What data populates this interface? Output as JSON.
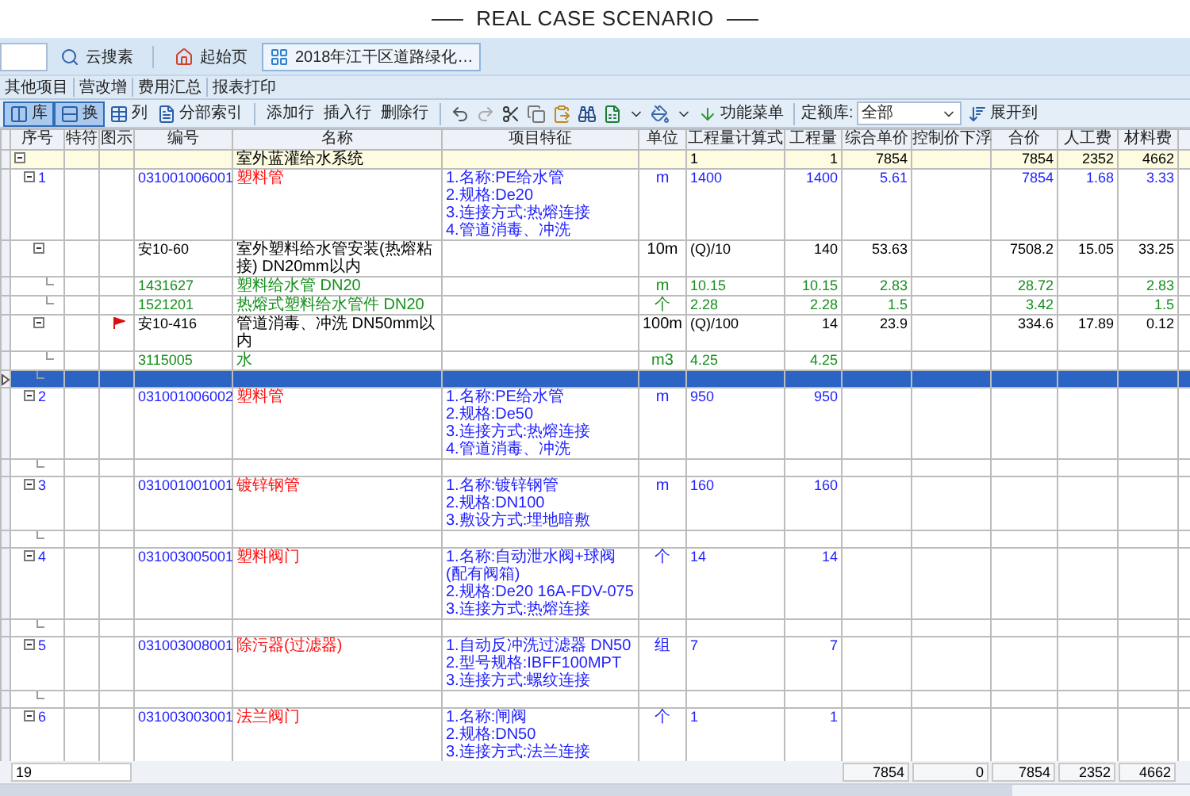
{
  "page_title": "REAL CASE SCENARIO",
  "cloud_search": {
    "label": "云搜素"
  },
  "tabs": [
    {
      "label": "起始页",
      "kind": "home",
      "selected": false
    },
    {
      "label": "2018年江干区道路绿化…",
      "kind": "document",
      "selected": true
    }
  ],
  "menu": [
    "其他项目",
    "营改增",
    "费用汇总",
    "报表打印"
  ],
  "view_toggles": [
    {
      "label": "库",
      "kind": "columns",
      "selected": true
    },
    {
      "label": "换",
      "kind": "rows",
      "selected": true
    }
  ],
  "toolbar_buttons": [
    {
      "label": "列",
      "kind": "table"
    },
    {
      "label": "分部索引",
      "kind": "index"
    }
  ],
  "row_actions": [
    "添加行",
    "插入行",
    "删除行"
  ],
  "function_menu": "功能菜单",
  "quota_library": {
    "label": "定额库:",
    "value": "全部"
  },
  "expand_to": "展开到",
  "table": {
    "columns": [
      "序号",
      "特符",
      "图示",
      "编号",
      "名称",
      "项目特征",
      "单位",
      "工程量计算式",
      "工程量",
      "综合单价",
      "控制价下浮",
      "合价",
      "人工费",
      "材料费"
    ],
    "rows": [
      {
        "kind": "group",
        "selected": false,
        "flagged": false,
        "expanded": true,
        "name": "室外蓝灌给水系统",
        "formula": "1",
        "quantity": "1",
        "unit_price": "7854",
        "total": "7854",
        "labor": "2352",
        "material": "4662",
        "children": [
          {
            "kind": "item",
            "selected": false,
            "flagged": false,
            "expanded": true,
            "no": "1",
            "code": "031001006001",
            "name": "塑料管",
            "features": [
              "1.名称:PE给水管",
              "2.规格:De20",
              "3.连接方式:热熔连接",
              "4.管道消毒、冲洗"
            ],
            "unit": "m",
            "formula": "1400",
            "quantity": "1400",
            "unit_price": "5.61",
            "total": "7854",
            "labor": "1.68",
            "material": "3.33",
            "children": [
              {
                "kind": "quota",
                "selected": false,
                "flagged": false,
                "expanded": true,
                "code": "安10-60",
                "name": "室外塑料给水管安装(热熔粘接) DN20mm以内",
                "unit": "10m",
                "formula": "(Q)/10",
                "quantity": "140",
                "unit_price": "53.63",
                "total": "7508.2",
                "labor": "15.05",
                "material": "33.25",
                "children": [
                  {
                    "kind": "material",
                    "selected": false,
                    "flagged": false,
                    "code": "1431627",
                    "name": "塑料给水管 DN20",
                    "unit": "m",
                    "formula": "10.15",
                    "quantity": "10.15",
                    "unit_price": "2.83",
                    "total": "28.72",
                    "material": "2.83"
                  },
                  {
                    "kind": "material",
                    "selected": false,
                    "flagged": false,
                    "code": "1521201",
                    "name": "热熔式塑料给水管件 DN20",
                    "unit": "个",
                    "formula": "2.28",
                    "quantity": "2.28",
                    "unit_price": "1.5",
                    "total": "3.42",
                    "material": "1.5"
                  }
                ]
              },
              {
                "kind": "quota",
                "selected": false,
                "flagged": true,
                "expanded": true,
                "code": "安10-416",
                "name": "管道消毒、冲洗 DN50mm以内",
                "unit": "100m",
                "formula": "(Q)/100",
                "quantity": "14",
                "unit_price": "23.9",
                "total": "334.6",
                "labor": "17.89",
                "material": "0.12",
                "children": [
                  {
                    "kind": "material",
                    "selected": false,
                    "flagged": false,
                    "code": "3115005",
                    "name": "水",
                    "unit": "m3",
                    "formula": "4.25",
                    "quantity": "4.25"
                  }
                ]
              },
              {
                "kind": "blank",
                "selected": true,
                "flagged": false
              }
            ]
          },
          {
            "kind": "item",
            "selected": false,
            "flagged": false,
            "expanded": true,
            "no": "2",
            "code": "031001006002",
            "name": "塑料管",
            "features": [
              "1.名称:PE给水管",
              "2.规格:De50",
              "3.连接方式:热熔连接",
              "4.管道消毒、冲洗"
            ],
            "unit": "m",
            "formula": "950",
            "quantity": "950",
            "children": [
              {
                "kind": "blank",
                "selected": false,
                "flagged": false
              }
            ]
          },
          {
            "kind": "item",
            "selected": false,
            "flagged": false,
            "expanded": true,
            "no": "3",
            "code": "031001001001",
            "name": "镀锌钢管",
            "features": [
              "1.名称:镀锌钢管",
              "2.规格:DN100",
              "3.敷设方式:埋地暗敷"
            ],
            "unit": "m",
            "formula": "160",
            "quantity": "160",
            "children": [
              {
                "kind": "blank",
                "selected": false,
                "flagged": false
              }
            ]
          },
          {
            "kind": "item",
            "selected": false,
            "flagged": false,
            "expanded": true,
            "no": "4",
            "code": "031003005001",
            "name": "塑料阀门",
            "features": [
              "1.名称:自动泄水阀+球阀(配有阀箱)",
              "2.规格:De20 16A-FDV-075",
              "3.连接方式:热熔连接"
            ],
            "unit": "个",
            "formula": "14",
            "quantity": "14",
            "children": [
              {
                "kind": "blank",
                "selected": false,
                "flagged": false
              }
            ]
          },
          {
            "kind": "item",
            "selected": false,
            "flagged": false,
            "expanded": true,
            "no": "5",
            "code": "031003008001",
            "name": "除污器(过滤器)",
            "features": [
              "1.自动反冲洗过滤器 DN50",
              "2.型号规格:IBFF100MPT",
              "3.连接方式:螺纹连接"
            ],
            "unit": "组",
            "formula": "7",
            "quantity": "7",
            "children": [
              {
                "kind": "blank",
                "selected": false,
                "flagged": false
              }
            ]
          },
          {
            "kind": "item",
            "selected": false,
            "flagged": false,
            "expanded": true,
            "no": "6",
            "code": "031003003001",
            "name": "法兰阀门",
            "features": [
              "1.名称:闸阀",
              "2.规格:DN50",
              "3.连接方式:法兰连接"
            ],
            "unit": "个",
            "formula": "1",
            "quantity": "1"
          }
        ]
      }
    ],
    "footer": {
      "count": "19",
      "totals": [
        "7854",
        "0",
        "7854",
        "2352",
        "4662"
      ]
    }
  }
}
